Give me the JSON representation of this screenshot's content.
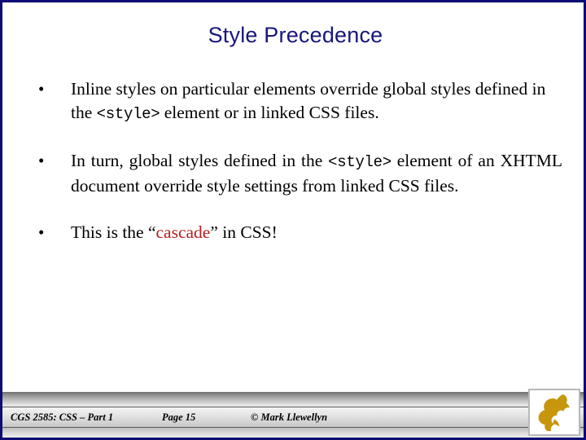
{
  "slide": {
    "title": "Style Precedence",
    "title_color": "#17177c",
    "border_color": "#0d0d73",
    "background_color": "#ffffff"
  },
  "body": {
    "bullet_glyph": "•",
    "bullets": [
      {
        "id": "bullet-inline-override",
        "parts": [
          {
            "text": "Inline styles on particular elements override global styles defined in the ",
            "style": "normal"
          },
          {
            "text": "<style>",
            "style": "code"
          },
          {
            "text": " element or in linked CSS files.",
            "style": "normal"
          }
        ]
      },
      {
        "id": "bullet-global-override",
        "parts": [
          {
            "text": "In turn, global styles defined in the ",
            "style": "normal"
          },
          {
            "text": "<style>",
            "style": "code"
          },
          {
            "text": " element of an XHTML document override style settings from linked CSS files.",
            "style": "normal"
          }
        ]
      },
      {
        "id": "bullet-cascade",
        "parts": [
          {
            "text": "This is the “",
            "style": "normal"
          },
          {
            "text": "cascade",
            "style": "accent"
          },
          {
            "text": "” in CSS!",
            "style": "normal"
          }
        ]
      }
    ],
    "accent_color": "#b81f1f"
  },
  "footer": {
    "course": "CGS 2585: CSS – Part 1",
    "page": "Page 15",
    "credit": "© Mark Llewellyn",
    "logo_name": "ucf-pegasus-logo",
    "logo_color": "#c8960c"
  }
}
